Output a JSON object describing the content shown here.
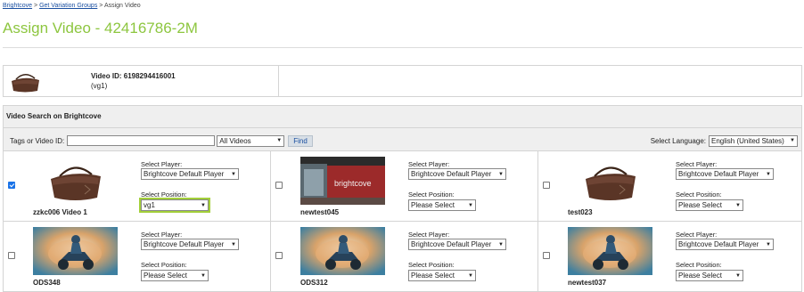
{
  "breadcrumb": {
    "items": [
      "Brightcove",
      "Get Variation Groups"
    ],
    "separator": ">",
    "current": "Assign Video"
  },
  "page_title": "Assign Video - 42416786-2M",
  "video_info": {
    "video_id_text": "Video ID: 6198294416001",
    "group_text": "(vg1)",
    "thumbnail_icon": "handbag-thumbnail"
  },
  "search": {
    "header": "Video Search on Brightcove",
    "tags_label": "Tags or Video ID:",
    "tags_value": "",
    "scope_selected": "All Videos",
    "find_label": "Find",
    "language_label": "Select Language:",
    "language_selected": "English (United States)"
  },
  "cards": [
    {
      "name": "zzkc006 Video 1",
      "checked": true,
      "thumbnail": "handbag-thumbnail",
      "player_label": "Select Player:",
      "player_selected": "Brightcove Default Player",
      "position_label": "Select Position:",
      "position_selected": "vg1"
    },
    {
      "name": "newtest045",
      "checked": false,
      "thumbnail": "brightcove-office-thumbnail",
      "player_label": "Select Player:",
      "player_selected": "Brightcove Default Player",
      "position_label": "Select Position:",
      "position_selected": "Please Select"
    },
    {
      "name": "test023",
      "checked": false,
      "thumbnail": "handbag-thumbnail",
      "player_label": "Select Player:",
      "player_selected": "Brightcove Default Player",
      "position_label": "Select Position:",
      "position_selected": "Please Select"
    },
    {
      "name": "ODS348",
      "checked": false,
      "thumbnail": "atv-rider-thumbnail",
      "player_label": "Select Player:",
      "player_selected": "Brightcove Default Player",
      "position_label": "Select Position:",
      "position_selected": "Please Select"
    },
    {
      "name": "ODS312",
      "checked": false,
      "thumbnail": "atv-rider-thumbnail",
      "player_label": "Select Player:",
      "player_selected": "Brightcove Default Player",
      "position_label": "Select Position:",
      "position_selected": "Please Select"
    },
    {
      "name": "newtest037",
      "checked": false,
      "thumbnail": "atv-rider-thumbnail",
      "player_label": "Select Player:",
      "player_selected": "Brightcove Default Player",
      "position_label": "Select Position:",
      "position_selected": "Please Select"
    }
  ],
  "office_sign_text": "brightcove",
  "colors": {
    "title_green": "#8dc63f",
    "link_blue": "#1a4fa0",
    "highlight_green": "#a3cf3a",
    "checkbox_blue": "#1a73e8"
  }
}
